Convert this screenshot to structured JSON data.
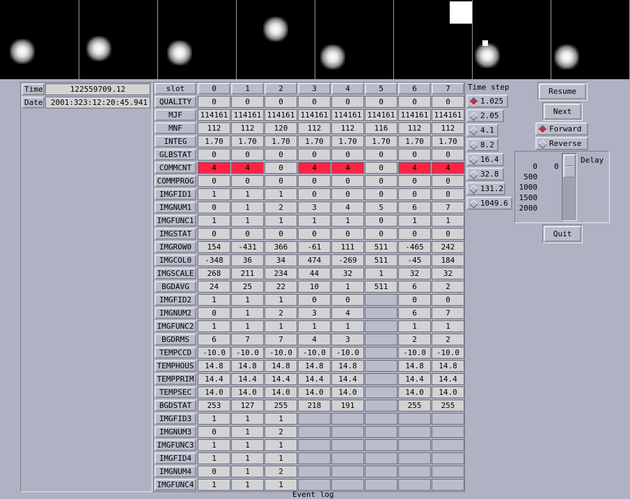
{
  "left_panel": {
    "time_label": "Time",
    "time_value": "122559709.12",
    "date_label": "Date",
    "date_value": "2001:323:12:20:45.941"
  },
  "table": {
    "row_headers": [
      "slot",
      "QUALITY",
      "MJF",
      "MNF",
      "INTEG",
      "GLBSTAT",
      "COMMCNT",
      "COMMPROG",
      "IMGFID1",
      "IMGNUM1",
      "IMGFUNC1",
      "IMGSTAT",
      "IMGROW0",
      "IMGCOL0",
      "IMGSCALE",
      "BGDAVG",
      "IMGFID2",
      "IMGNUM2",
      "IMGFUNC2",
      "BGDRMS",
      "TEMPCCD",
      "TEMPHOUS",
      "TEMPPRIM",
      "TEMPSEC",
      "BGDSTAT",
      "IMGFID3",
      "IMGNUM3",
      "IMGFUNC3",
      "IMGFID4",
      "IMGNUM4",
      "IMGFUNC4"
    ],
    "rows": [
      [
        "0",
        "1",
        "2",
        "3",
        "4",
        "5",
        "6",
        "7"
      ],
      [
        "0",
        "0",
        "0",
        "0",
        "0",
        "0",
        "0",
        "0"
      ],
      [
        "114161",
        "114161",
        "114161",
        "114161",
        "114161",
        "114161",
        "114161",
        "114161"
      ],
      [
        "112",
        "112",
        "120",
        "112",
        "112",
        "116",
        "112",
        "112"
      ],
      [
        "1.70",
        "1.70",
        "1.70",
        "1.70",
        "1.70",
        "1.70",
        "1.70",
        "1.70"
      ],
      [
        "0",
        "0",
        "0",
        "0",
        "0",
        "0",
        "0",
        "0"
      ],
      [
        "4",
        "4",
        "0",
        "4",
        "4",
        "0",
        "4",
        "4"
      ],
      [
        "0",
        "0",
        "0",
        "0",
        "0",
        "0",
        "0",
        "0"
      ],
      [
        "1",
        "1",
        "1",
        "0",
        "0",
        "0",
        "0",
        "0"
      ],
      [
        "0",
        "1",
        "2",
        "3",
        "4",
        "5",
        "6",
        "7"
      ],
      [
        "1",
        "1",
        "1",
        "1",
        "1",
        "0",
        "1",
        "1"
      ],
      [
        "0",
        "0",
        "0",
        "0",
        "0",
        "0",
        "0",
        "0"
      ],
      [
        "154",
        "-431",
        "366",
        "-61",
        "111",
        "511",
        "-465",
        "242"
      ],
      [
        "-348",
        "36",
        "34",
        "474",
        "-269",
        "511",
        "-45",
        "184"
      ],
      [
        "268",
        "211",
        "234",
        "44",
        "32",
        "1",
        "32",
        "32"
      ],
      [
        "24",
        "25",
        "22",
        "10",
        "1",
        "511",
        "6",
        "2"
      ],
      [
        "1",
        "1",
        "1",
        "0",
        "0",
        "",
        "0",
        "0"
      ],
      [
        "0",
        "1",
        "2",
        "3",
        "4",
        "",
        "6",
        "7"
      ],
      [
        "1",
        "1",
        "1",
        "1",
        "1",
        "",
        "1",
        "1"
      ],
      [
        "6",
        "7",
        "7",
        "4",
        "3",
        "",
        "2",
        "2"
      ],
      [
        "-10.0",
        "-10.0",
        "-10.0",
        "-10.0",
        "-10.0",
        "",
        "-10.0",
        "-10.0"
      ],
      [
        "14.8",
        "14.8",
        "14.8",
        "14.8",
        "14.8",
        "",
        "14.8",
        "14.8"
      ],
      [
        "14.4",
        "14.4",
        "14.4",
        "14.4",
        "14.4",
        "",
        "14.4",
        "14.4"
      ],
      [
        "14.0",
        "14.0",
        "14.0",
        "14.0",
        "14.0",
        "",
        "14.0",
        "14.0"
      ],
      [
        "253",
        "127",
        "255",
        "218",
        "191",
        "",
        "255",
        "255"
      ],
      [
        "1",
        "1",
        "1",
        "",
        "",
        "",
        "",
        ""
      ],
      [
        "0",
        "1",
        "2",
        "",
        "",
        "",
        "",
        ""
      ],
      [
        "1",
        "1",
        "1",
        "",
        "",
        "",
        "",
        ""
      ],
      [
        "1",
        "1",
        "1",
        "",
        "",
        "",
        "",
        ""
      ],
      [
        "0",
        "1",
        "2",
        "",
        "",
        "",
        "",
        ""
      ],
      [
        "1",
        "1",
        "1",
        "",
        "",
        "",
        "",
        ""
      ]
    ],
    "highlight_color": "#ff2244",
    "highlighted_row": "COMMCNT",
    "highlighted_slots": [
      0,
      1,
      3,
      4,
      6,
      7
    ]
  },
  "timestep": {
    "title": "Time step",
    "options": [
      "1.025",
      "2.05",
      "4.1",
      "8.2",
      "16.4",
      "32.8",
      "131.2",
      "1049.6"
    ],
    "selected": "1.025"
  },
  "controls": {
    "resume_label": "Resume",
    "next_label": "Next",
    "forward_label": "Forward",
    "reverse_label": "Reverse",
    "direction_selected": "Forward",
    "delay_label": "Delay",
    "delay_value": "0",
    "delay_ticks": [
      "0",
      "500",
      "1000",
      "1500",
      "2000"
    ],
    "quit_label": "Quit"
  },
  "footer": {
    "event_log_label": "Event log"
  }
}
